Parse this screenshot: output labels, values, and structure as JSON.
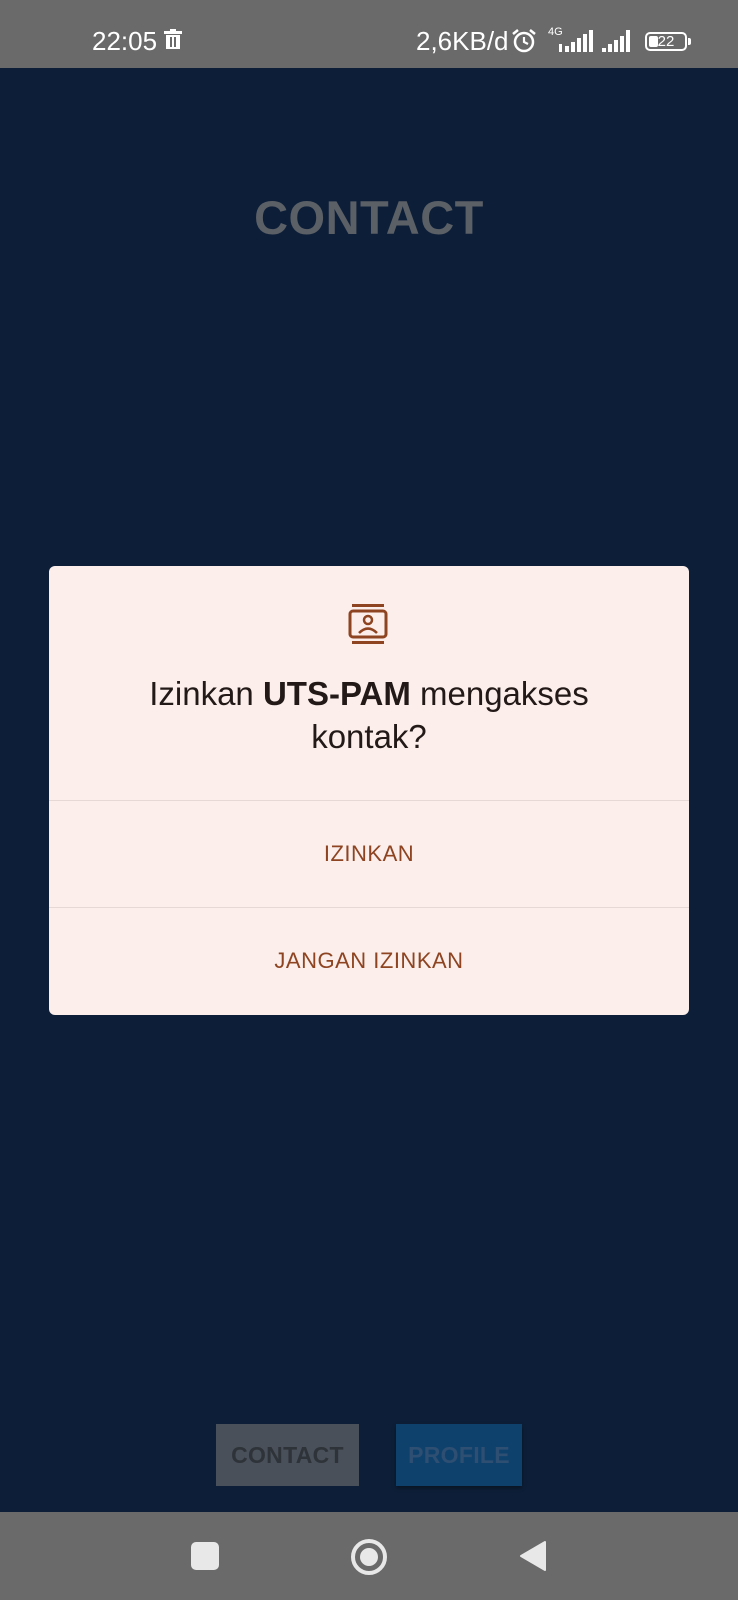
{
  "status_bar": {
    "time": "22:05",
    "data_speed": "2,6KB/d",
    "network_type": "4G",
    "battery": "22"
  },
  "app": {
    "title": "CONTACT",
    "buttons": {
      "contact": "CONTACT",
      "profile": "PROFILE"
    }
  },
  "dialog": {
    "icon": "contacts-icon",
    "message_prefix": "Izinkan ",
    "app_name": "UTS-PAM",
    "message_suffix": " mengakses kontak?",
    "allow": "IZINKAN",
    "deny": "JANGAN IZINKAN",
    "accent_color": "#8e4421"
  },
  "nav_bar": {
    "recent": "recent-apps-icon",
    "home": "home-icon",
    "back": "back-icon"
  }
}
